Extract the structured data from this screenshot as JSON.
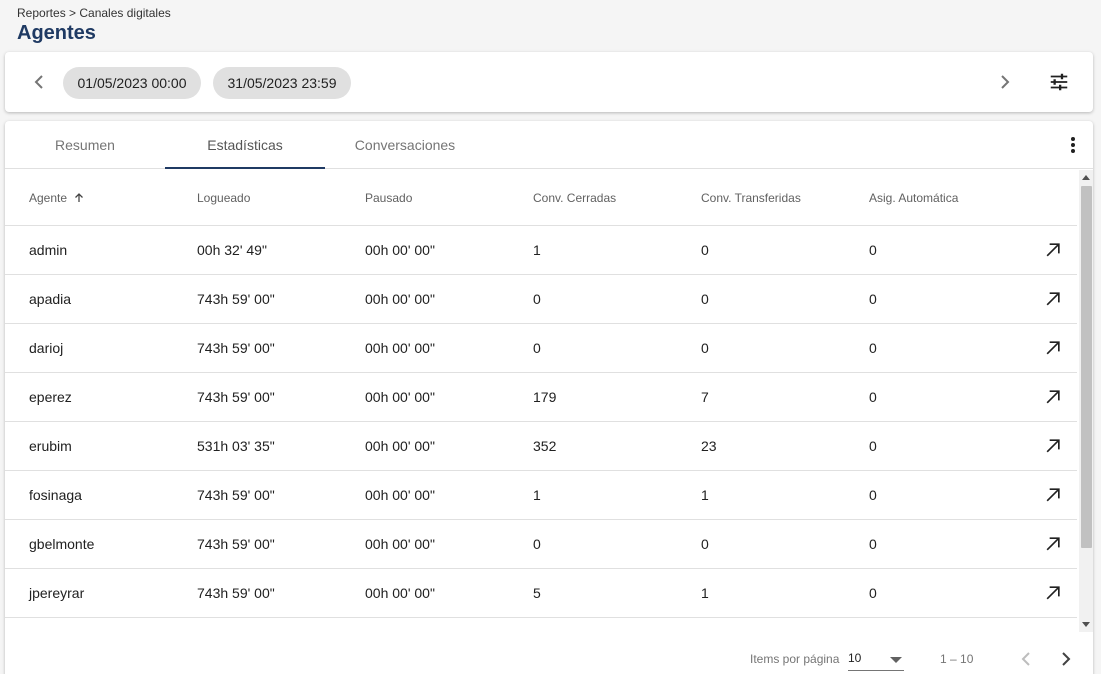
{
  "breadcrumb": "Reportes > Canales digitales",
  "title": "Agentes",
  "date_range": {
    "start": "01/05/2023 00:00",
    "end": "31/05/2023 23:59"
  },
  "tabs": [
    {
      "label": "Resumen",
      "active": false
    },
    {
      "label": "Estadísticas",
      "active": true
    },
    {
      "label": "Conversaciones",
      "active": false
    }
  ],
  "table": {
    "columns": [
      "Agente",
      "Logueado",
      "Pausado",
      "Conv. Cerradas",
      "Conv. Transferidas",
      "Asig. Automática"
    ],
    "sort": {
      "column": "Agente",
      "direction": "asc"
    },
    "rows": [
      [
        "admin",
        "00h 32' 49\"",
        "00h 00' 00\"",
        "1",
        "0",
        "0"
      ],
      [
        "apadia",
        "743h 59' 00\"",
        "00h 00' 00\"",
        "0",
        "0",
        "0"
      ],
      [
        "darioj",
        "743h 59' 00\"",
        "00h 00' 00\"",
        "0",
        "0",
        "0"
      ],
      [
        "eperez",
        "743h 59' 00\"",
        "00h 00' 00\"",
        "179",
        "7",
        "0"
      ],
      [
        "erubim",
        "531h 03' 35\"",
        "00h 00' 00\"",
        "352",
        "23",
        "0"
      ],
      [
        "fosinaga",
        "743h 59' 00\"",
        "00h 00' 00\"",
        "1",
        "1",
        "0"
      ],
      [
        "gbelmonte",
        "743h 59' 00\"",
        "00h 00' 00\"",
        "0",
        "0",
        "0"
      ],
      [
        "jpereyrar",
        "743h 59' 00\"",
        "00h 00' 00\"",
        "5",
        "1",
        "0"
      ],
      [
        "",
        "",
        "",
        "",
        "",
        ""
      ]
    ]
  },
  "paginator": {
    "items_label": "Items por página",
    "page_size": "10",
    "range": "1 – 10"
  },
  "icons": {
    "prev": "chevron-left-icon",
    "next": "chevron-right-icon",
    "filter": "tune-icon",
    "more": "more-vert-icon",
    "sort": "arrow-upward-icon",
    "open": "arrow-outward-icon"
  },
  "colors": {
    "accent": "#1f3a63",
    "chip": "#e0e0e0",
    "background": "#f5f5f5"
  }
}
